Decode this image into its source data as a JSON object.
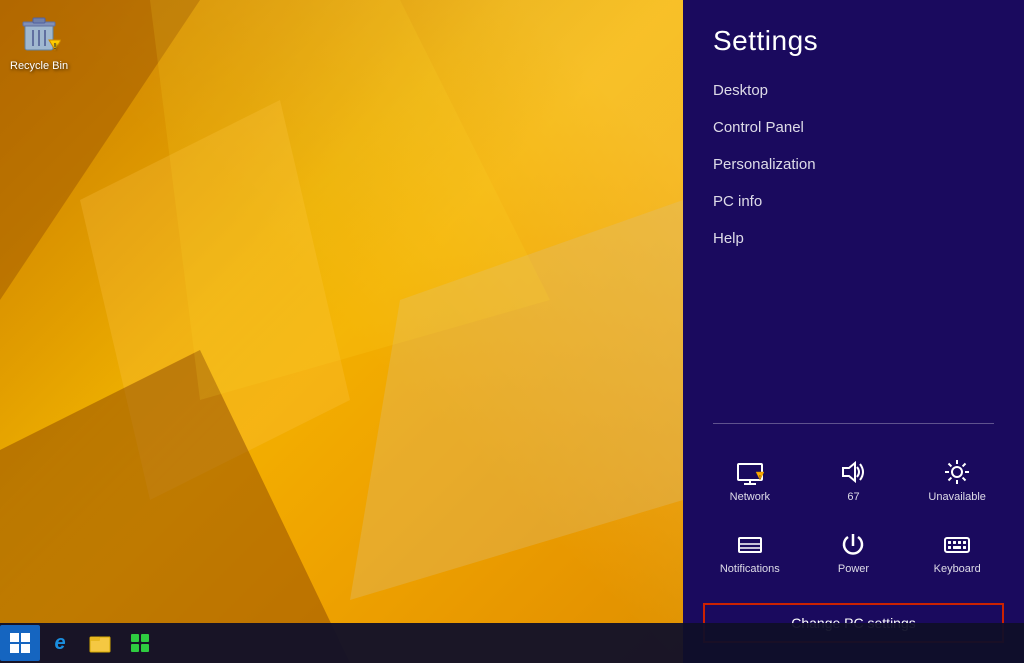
{
  "desktop": {
    "recycle_bin_label": "Recycle Bin",
    "recycle_bin_icon": "🗑"
  },
  "taskbar": {
    "start_icon": "⊞",
    "ie_icon": "e",
    "file_explorer_icon": "📁",
    "store_icon": "🛍"
  },
  "settings": {
    "title": "Settings",
    "menu_items": [
      {
        "id": "desktop",
        "label": "Desktop"
      },
      {
        "id": "control-panel",
        "label": "Control Panel"
      },
      {
        "id": "personalization",
        "label": "Personalization"
      },
      {
        "id": "pc-info",
        "label": "PC info"
      },
      {
        "id": "help",
        "label": "Help"
      }
    ],
    "quick_access": [
      {
        "id": "network",
        "label": "Network"
      },
      {
        "id": "volume",
        "label": "67"
      },
      {
        "id": "brightness",
        "label": "Unavailable"
      },
      {
        "id": "notifications",
        "label": "Notifications"
      },
      {
        "id": "power",
        "label": "Power"
      },
      {
        "id": "keyboard",
        "label": "Keyboard"
      }
    ],
    "change_pc_settings_label": "Change PC settings"
  }
}
